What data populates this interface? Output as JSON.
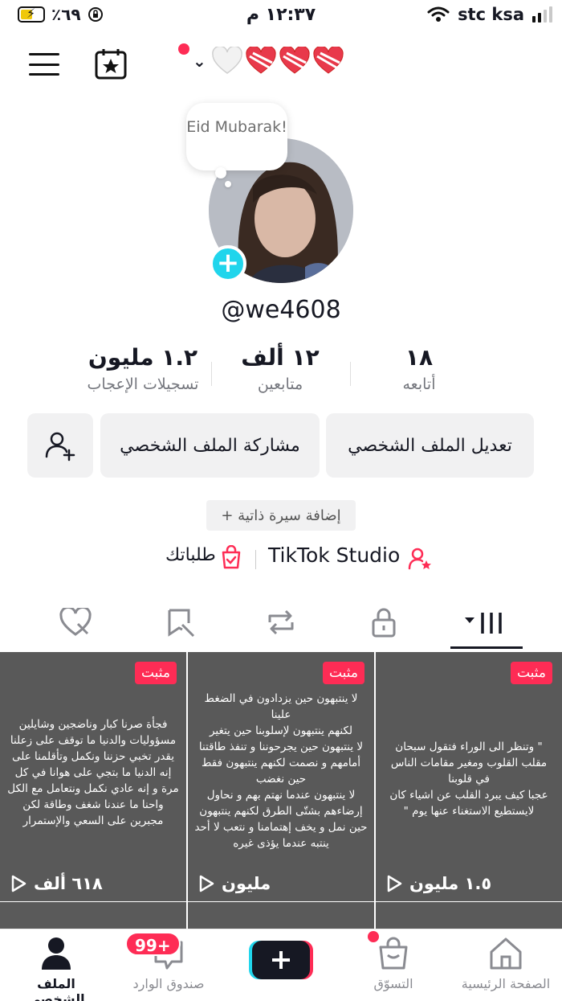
{
  "status_bar": {
    "battery_percent": "٪٦٩",
    "time": "١٢:٣٧ م",
    "carrier": "stc ksa"
  },
  "top_bar": {
    "icons": [
      "menu-icon",
      "calendar-star-icon",
      "chevron-down-icon",
      "heart-icons"
    ]
  },
  "profile": {
    "bubble_text": "Eid Mubarak!",
    "username": "@we4608",
    "stats": [
      {
        "value": "١.٢ مليون",
        "label": "تسجيلات الإعجاب"
      },
      {
        "value": "١٢ ألف",
        "label": "متابعين"
      },
      {
        "value": "١٨",
        "label": "أتابعه"
      }
    ],
    "buttons": {
      "edit": "تعديل الملف الشخصي",
      "share": "مشاركة الملف الشخصي"
    },
    "bio_button": "+ إضافة سيرة ذاتية",
    "links": {
      "studio": "TikTok Studio",
      "orders": "طلباتك"
    }
  },
  "videos": [
    {
      "pinned_label": "مثبت",
      "views": "١.٥ مليون",
      "text": "\" وتنظر الى الوراء فتقول سبحان مقلب القلوب ومغير مقامات الناس في قلوبنا\nعجبا كيف يبرد القلب عن اشياء كان لايستطيع الاستغناء عنها يوم \""
    },
    {
      "pinned_label": "مثبت",
      "views": "مليون",
      "text": "لا ينتبهون حين يزدادون في الضغط علينا\nلكنهم ينتبهون لإسلوبنا حين يتغير\nلا ينتبهون حين يجرحوننا و تنفذ طاقتنا أمامهم و نصمت لكنهم ينتبهون فقط حين نغضب\nلا ينتبهون عندما نهتم بهم و نحاول إرضاءهم بشتّى الطرق لكنهم ينتبهون حين نمل و يخف إهتمامنا و نتعب لا أحد ينتبه عندما يؤذى غيره"
    },
    {
      "pinned_label": "مثبت",
      "views": "٦١٨ ألف",
      "text": "فجأة صرنا كبار وناضجين وشايلين مسؤوليات والدنيا ما توقف على زعلنا يقدر تخبي حزننا ونكمل وتأقلمنا على إنه الدنيا ما بتجي على هوانا في كل مرة و إنه عادي نكمل ونتعامل مع الكل واحنا ما عندنا شغف وطاقة لكن مجبرين على السعي والإستمرار"
    }
  ],
  "bottom_nav": {
    "home": "الصفحة الرئيسية",
    "shop": "التسوّق",
    "inbox": "صندوق الوارد",
    "inbox_badge": "99+",
    "profile": "الملف الشخصي"
  },
  "colors": {
    "accent": "#fe2c55",
    "cyan": "#20d5ec",
    "button_bg": "#f1f1f2",
    "tile_bg": "#595959"
  }
}
